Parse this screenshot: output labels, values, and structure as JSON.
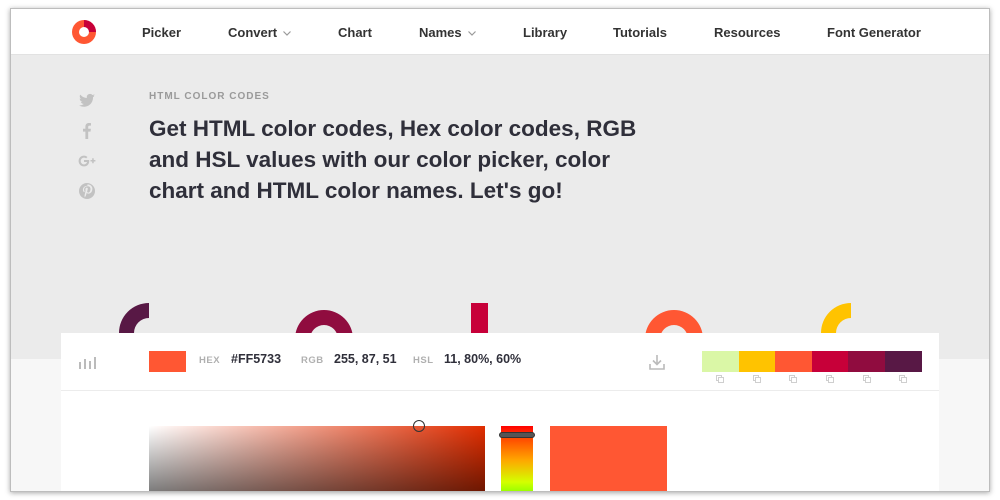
{
  "nav": {
    "items": [
      {
        "label": "Picker",
        "has_dropdown": false
      },
      {
        "label": "Convert",
        "has_dropdown": true
      },
      {
        "label": "Chart",
        "has_dropdown": false
      },
      {
        "label": "Names",
        "has_dropdown": true
      },
      {
        "label": "Library",
        "has_dropdown": false
      },
      {
        "label": "Tutorials",
        "has_dropdown": false
      },
      {
        "label": "Resources",
        "has_dropdown": false
      },
      {
        "label": "Font Generator",
        "has_dropdown": false
      }
    ],
    "brand_color": "#ff5733"
  },
  "share": [
    "twitter-icon",
    "facebook-icon",
    "google-plus-icon",
    "pinterest-icon"
  ],
  "hero": {
    "eyebrow": "HTML COLOR CODES",
    "headline_line1": "Get HTML color codes, Hex color codes, RGB",
    "headline_line2": "and HSL values with our color picker, color",
    "headline_line3": "chart and HTML color names. Let's go!"
  },
  "picker": {
    "hex_label": "HEX",
    "hex_value": "#FF5733",
    "rgb_label": "RGB",
    "rgb_value": "255, 87, 51",
    "hsl_label": "HSL",
    "hsl_value": "11, 80%, 60%",
    "current_color": "#FF5733",
    "scheme": [
      "#DAF7A6",
      "#FFC300",
      "#FF5733",
      "#C70039",
      "#900C3F",
      "#581845"
    ]
  },
  "decor_colors": [
    "#581845",
    "#900C3F",
    "#C70039",
    "#FF5733",
    "#FFC300"
  ]
}
